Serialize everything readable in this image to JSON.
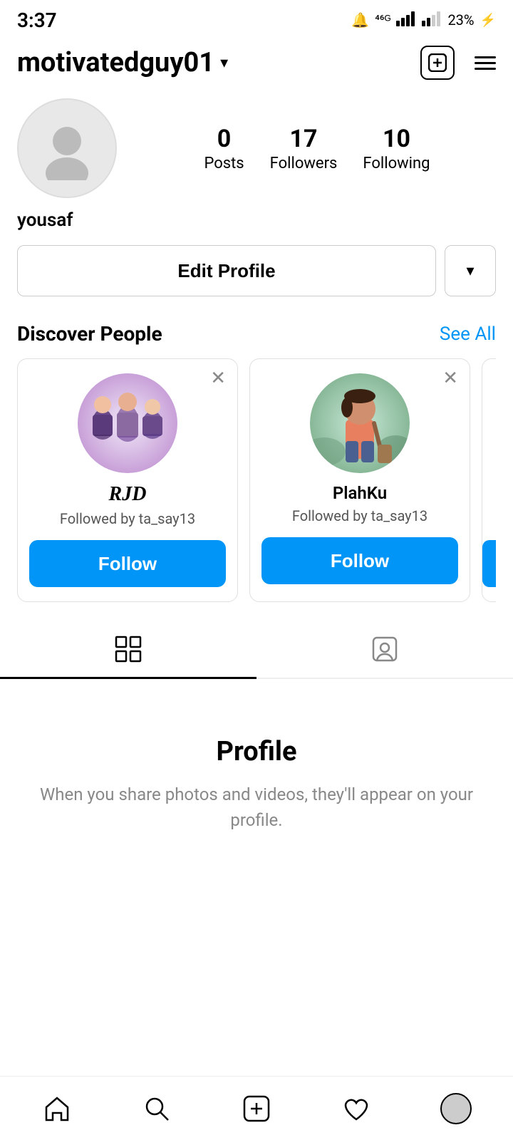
{
  "status_bar": {
    "time": "3:37",
    "battery": "23%",
    "signal_icons": "🔔 ⁴⁶ᴳ"
  },
  "header": {
    "username": "motivatedguy01",
    "dropdown_icon": "▾",
    "new_post_icon": "+",
    "menu_icon": "≡"
  },
  "profile": {
    "username": "yousaf",
    "stats": {
      "posts_count": "0",
      "posts_label": "Posts",
      "followers_count": "17",
      "followers_label": "Followers",
      "following_count": "10",
      "following_label": "Following"
    }
  },
  "edit_profile_btn": "Edit Profile",
  "discover": {
    "title": "Discover People",
    "see_all": "See All",
    "cards": [
      {
        "name": "RJD",
        "name_style": "script",
        "followed_by": "Followed by ta_say13",
        "follow_label": "Follow"
      },
      {
        "name": "PlahKu",
        "name_style": "normal",
        "followed_by": "Followed by ta_say13",
        "follow_label": "Follow"
      }
    ]
  },
  "tabs": {
    "grid_tab_label": "Grid",
    "tagged_tab_label": "Tagged"
  },
  "empty_state": {
    "title": "Profile",
    "description": "When you share photos and videos, they'll appear on your profile."
  },
  "bottom_nav": {
    "home_label": "Home",
    "search_label": "Search",
    "new_post_label": "New Post",
    "activity_label": "Activity",
    "profile_label": "Profile"
  }
}
